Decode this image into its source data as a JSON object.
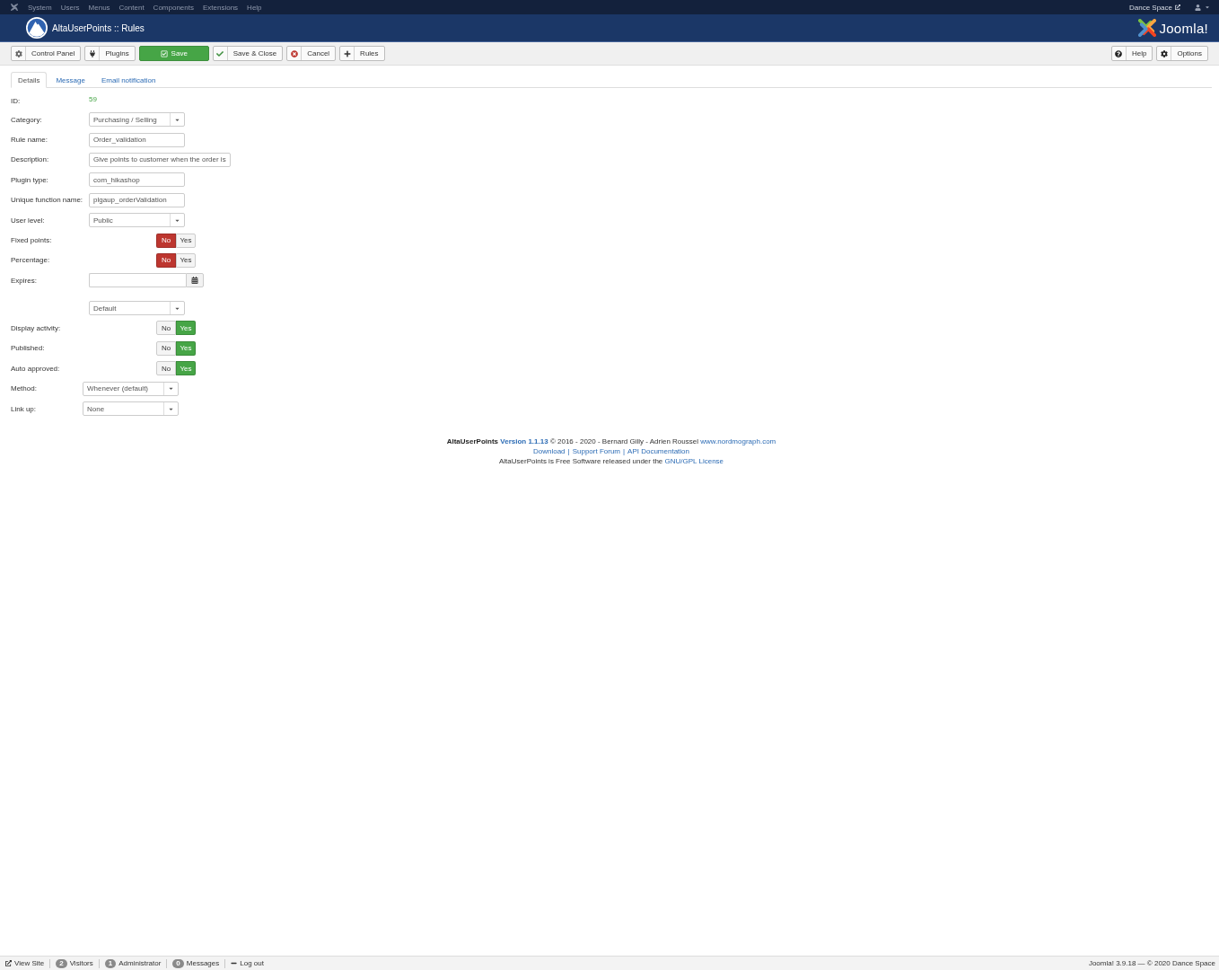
{
  "top_menu": {
    "items": [
      "System",
      "Users",
      "Menus",
      "Content",
      "Components",
      "Extensions",
      "Help"
    ],
    "site_link": "Dance Space"
  },
  "header": {
    "title": "AltaUserPoints :: Rules",
    "brand": "Joomla!"
  },
  "toolbar": {
    "left": [
      {
        "label": "Control Panel",
        "kind": "cpanel"
      },
      {
        "label": "Plugins",
        "kind": "plugins"
      },
      {
        "label": "Save",
        "kind": "save"
      },
      {
        "label": "Save & Close",
        "kind": "save-close"
      },
      {
        "label": "Cancel",
        "kind": "cancel"
      },
      {
        "label": "Rules",
        "kind": "rules"
      }
    ],
    "right": [
      {
        "label": "Help",
        "kind": "help"
      },
      {
        "label": "Options",
        "kind": "options"
      }
    ]
  },
  "tabs": [
    {
      "label": "Details",
      "selected": true
    },
    {
      "label": "Message",
      "selected": false
    },
    {
      "label": "Email notification",
      "selected": false
    }
  ],
  "fields": [
    {
      "label": "ID:",
      "kind": "value",
      "value": "59"
    },
    {
      "label": "Category:",
      "kind": "select",
      "value": "Purchasing / Selling"
    },
    {
      "label": "Rule name:",
      "kind": "input",
      "value": "Order_validation"
    },
    {
      "label": "Description:",
      "kind": "input",
      "value": "Give points to customer when the order is"
    },
    {
      "label": "Plugin type:",
      "kind": "input",
      "value": "com_hikashop"
    },
    {
      "label": "Unique function name:",
      "kind": "input",
      "value": "plgaup_orderValidation"
    },
    {
      "label": "User level:",
      "kind": "select",
      "value": "Public"
    },
    {
      "label": "Fixed points:",
      "kind": "toggle",
      "options": [
        {
          "label": "No",
          "kind": "negative",
          "selected": true
        },
        {
          "label": "Yes",
          "kind": "positive",
          "selected": false
        }
      ]
    },
    {
      "label": "Percentage:",
      "kind": "toggle",
      "options": [
        {
          "label": "No",
          "kind": "negative",
          "selected": true
        },
        {
          "label": "Yes",
          "kind": "positive",
          "selected": false
        }
      ]
    },
    {
      "label": "Expires:",
      "kind": "date"
    },
    {
      "kind": "select",
      "value": "Default"
    },
    {
      "label": "Display activity:",
      "kind": "toggle",
      "options": [
        {
          "label": "No",
          "kind": "negative",
          "selected": false
        },
        {
          "label": "Yes",
          "kind": "positive",
          "selected": true
        }
      ]
    },
    {
      "label": "Published:",
      "kind": "toggle",
      "options": [
        {
          "label": "No",
          "kind": "negative",
          "selected": false
        },
        {
          "label": "Yes",
          "kind": "positive",
          "selected": true
        }
      ]
    },
    {
      "label": "Auto approved:",
      "kind": "toggle",
      "options": [
        {
          "label": "No",
          "kind": "negative",
          "selected": false
        },
        {
          "label": "Yes",
          "kind": "positive",
          "selected": true
        }
      ]
    }
  ],
  "extra_fields": [
    {
      "label": "Method:",
      "kind": "select",
      "value": "Whenever (default)"
    },
    {
      "label": "Link up:",
      "kind": "select",
      "value": "None"
    }
  ],
  "footer": {
    "product": "AltaUserPoints",
    "version": "Version 1.1.13",
    "credits": "© 2016 - 2020 - Bernard Gilly - Adrien Roussel",
    "website": "www.nordmograph.com",
    "links": [
      "Download",
      "Support Forum",
      "API Documentation"
    ],
    "separator": "|",
    "license_text": "AltaUserPoints is Free Software released under the",
    "license_link": "GNU/GPL License"
  },
  "status_bar": {
    "items": [
      {
        "kind": "link",
        "label": "View Site"
      },
      {
        "kind": "count",
        "count": "2",
        "label": "Visitors"
      },
      {
        "kind": "count",
        "count": "1",
        "label": "Administrator"
      },
      {
        "kind": "count",
        "count": "0",
        "label": "Messages"
      },
      {
        "kind": "logout",
        "label": "Log out"
      }
    ],
    "version": "Joomla! 3.9.18 — © 2020 Dance Space"
  }
}
